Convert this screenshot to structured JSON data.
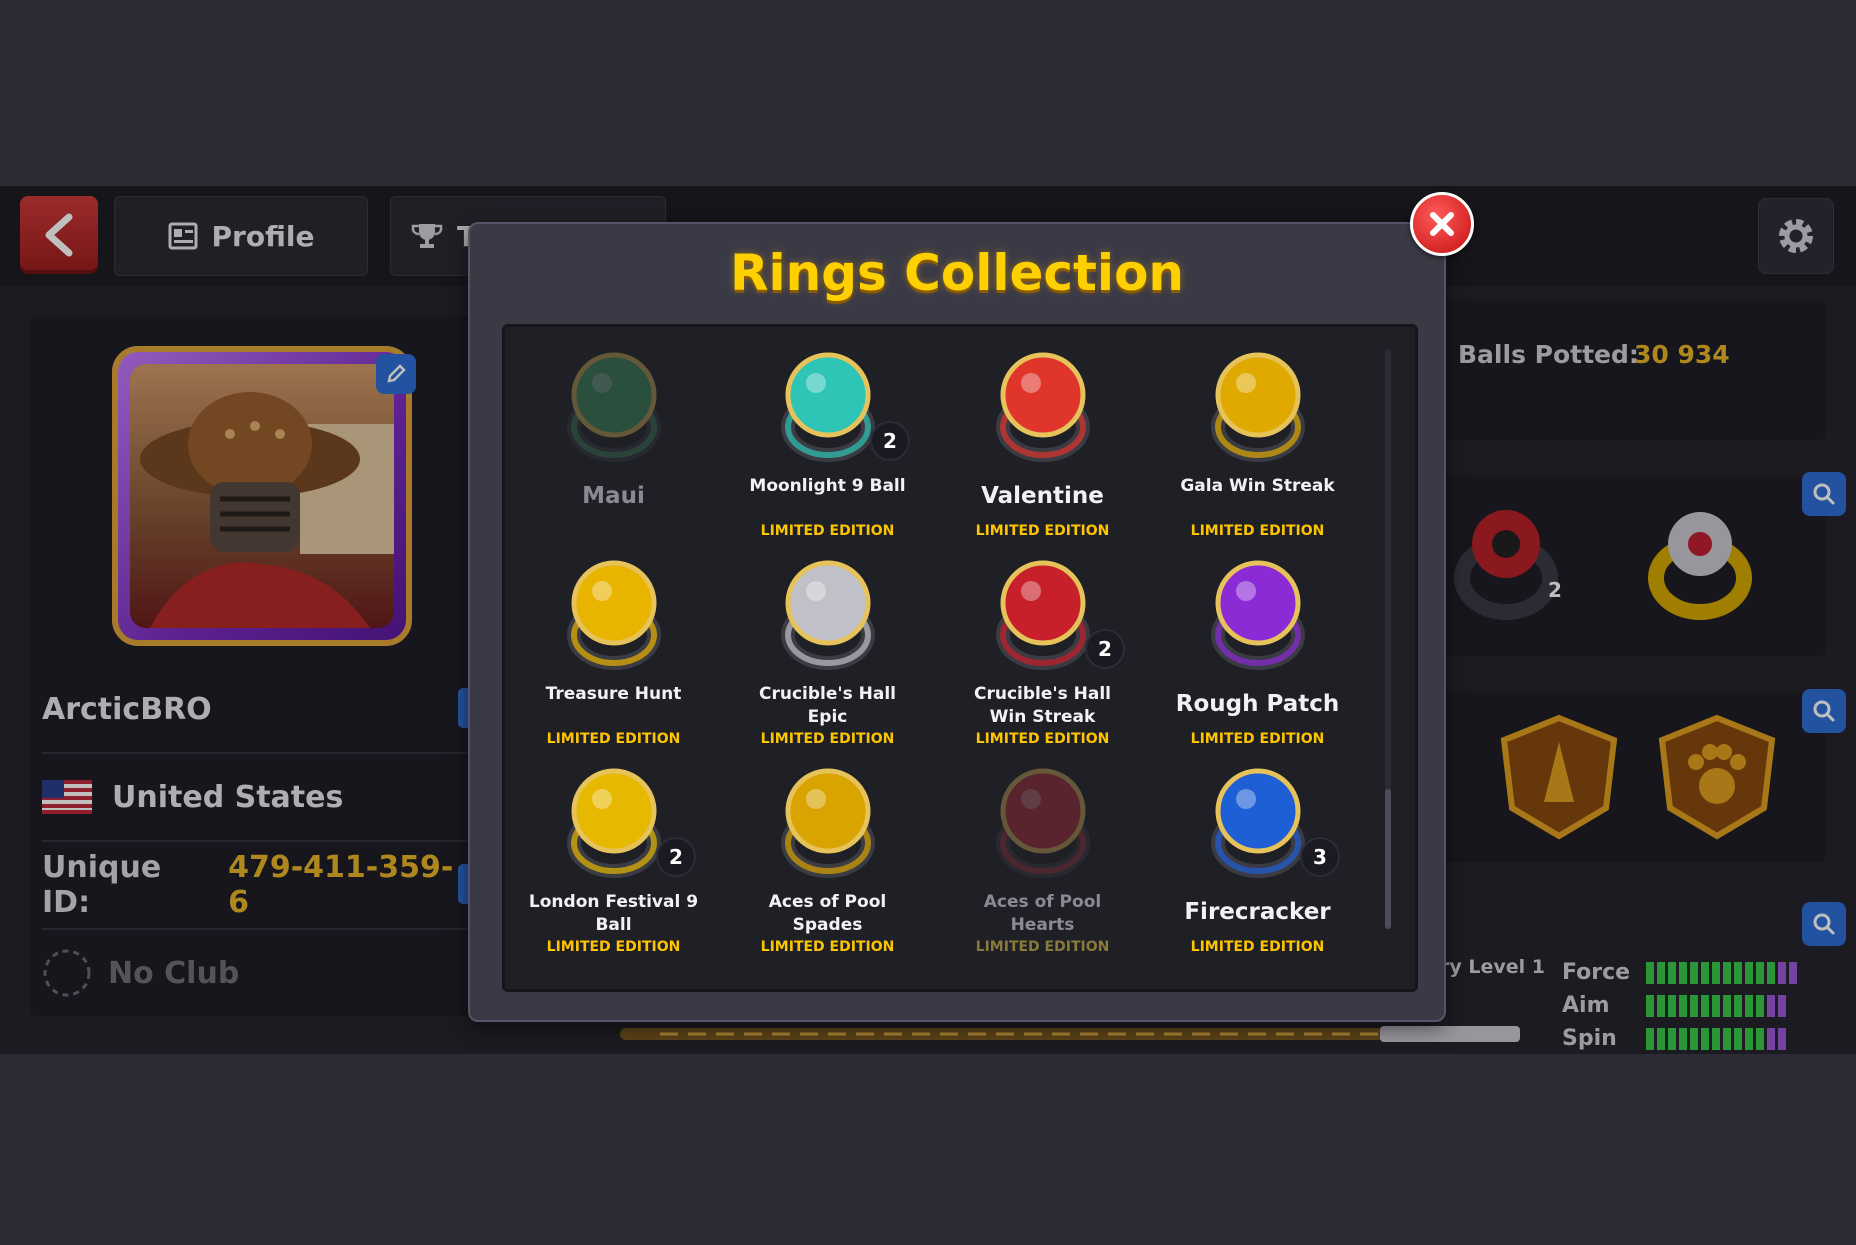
{
  "topbar": {
    "back_label": "",
    "profile_tab": "Profile",
    "trophy_tab": "Tr"
  },
  "profile": {
    "username": "ArcticBRO",
    "country": "United States",
    "unique_id_label": "Unique ID:",
    "unique_id_value": "479-411-359-6",
    "club": "No Club"
  },
  "stats": {
    "balls_potted_label": "Balls Potted:",
    "balls_potted_value": "30 934",
    "level_label": "ry Level 1",
    "force_label": "Force",
    "aim_label": "Aim",
    "spin_label": "Spin",
    "force_level": 0.83,
    "aim_level": 0.78,
    "spin_level": 0.78
  },
  "modal": {
    "title": "Rings Collection"
  },
  "rings": [
    {
      "name": "Maui",
      "edition": "",
      "count": "",
      "owned": false,
      "color": "#3fa86a"
    },
    {
      "name": "Moonlight 9 Ball",
      "edition": "LIMITED EDITION",
      "count": "2",
      "owned": true,
      "color": "#2ec4b6"
    },
    {
      "name": "Valentine",
      "edition": "LIMITED EDITION",
      "count": "",
      "owned": true,
      "color": "#e0352b"
    },
    {
      "name": "Gala Win Streak",
      "edition": "LIMITED EDITION",
      "count": "",
      "owned": true,
      "color": "#e0a900"
    },
    {
      "name": "Treasure Hunt",
      "edition": "LIMITED EDITION",
      "count": "",
      "owned": true,
      "color": "#e8b400"
    },
    {
      "name": "Crucible's Hall Epic",
      "edition": "LIMITED EDITION",
      "count": "",
      "owned": true,
      "color": "#c0c0c8"
    },
    {
      "name": "Crucible's Hall Win Streak",
      "edition": "LIMITED EDITION",
      "count": "2",
      "owned": true,
      "color": "#c8202a"
    },
    {
      "name": "Rough Patch",
      "edition": "LIMITED EDITION",
      "count": "",
      "owned": true,
      "color": "#8b2bd6"
    },
    {
      "name": "London Festival 9 Ball",
      "edition": "LIMITED EDITION",
      "count": "2",
      "owned": true,
      "color": "#e6b800"
    },
    {
      "name": "Aces of Pool Spades",
      "edition": "LIMITED EDITION",
      "count": "",
      "owned": true,
      "color": "#d9a400"
    },
    {
      "name": "Aces of Pool Hearts",
      "edition": "LIMITED EDITION",
      "count": "",
      "owned": false,
      "color": "#c83040"
    },
    {
      "name": "Firecracker",
      "edition": "LIMITED EDITION",
      "count": "3",
      "owned": true,
      "color": "#1f5fd6"
    }
  ]
}
